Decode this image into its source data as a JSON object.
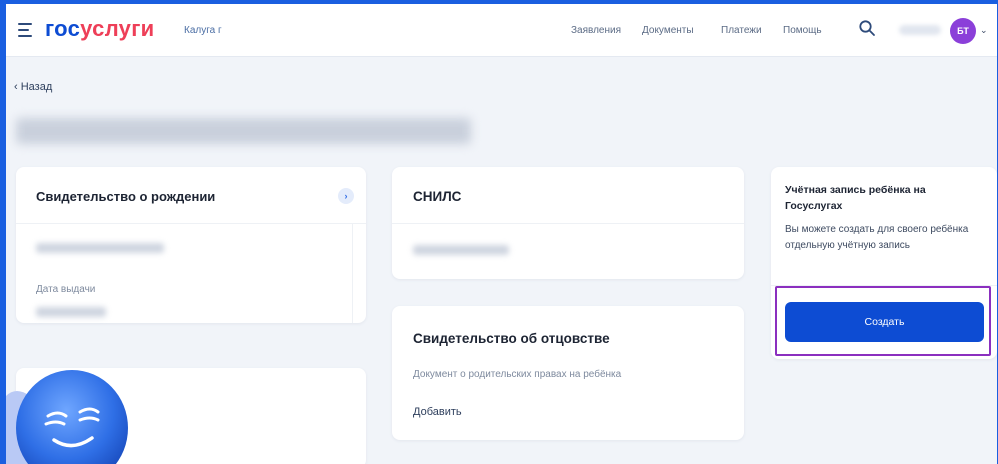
{
  "header": {
    "logo_part1": "гос",
    "logo_part2": "услуги",
    "city": "Калуга г",
    "nav": [
      "Заявления",
      "Документы",
      "Платежи",
      "Помощь"
    ],
    "avatar_initials": "БТ",
    "icons": [
      "menu-icon",
      "search-icon",
      "chevron-down-icon"
    ]
  },
  "back_label": "‹ Назад",
  "birth_card": {
    "title": "Свидетельство о рождении",
    "info_glyph": "›",
    "issue_date_label": "Дата выдачи"
  },
  "snils_card": {
    "title": "СНИЛС"
  },
  "paternity_card": {
    "title": "Свидетельство об отцовстве",
    "description": "Документ о родительских правах на ребёнка",
    "add_link": "Добавить"
  },
  "child_account": {
    "title": "Учётная запись ребёнка на Госуслугах",
    "description": "Вы можете создать для своего ребёнка отдельную учётную запись",
    "create_button": "Создать"
  },
  "colors": {
    "outer_frame": "#1a5fe0",
    "brand_blue": "#0d4cd3",
    "brand_red": "#ee3f58",
    "highlight": "#8b2fbf",
    "avatar": "#8b3fd9",
    "page_bg": "#f1f4f9"
  }
}
